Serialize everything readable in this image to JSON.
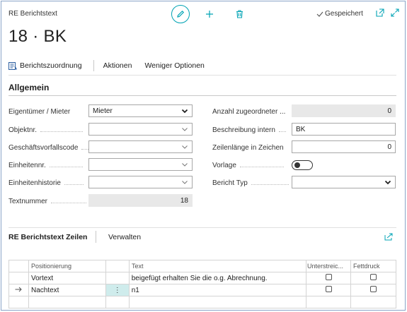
{
  "header": {
    "caption": "RE Berichtstext",
    "title": "18 · BK",
    "saved_label": "Gespeichert"
  },
  "actions": {
    "report_assignment": "Berichtszuordnung",
    "actions": "Aktionen",
    "fewer_options": "Weniger Optionen"
  },
  "general": {
    "section_title": "Allgemein",
    "left": [
      {
        "label": "Eigentümer / Mieter",
        "value": "Mieter"
      },
      {
        "label": "Objektnr.",
        "value": ""
      },
      {
        "label": "Geschäftsvorfallscode",
        "value": ""
      },
      {
        "label": "Einheitennr.",
        "value": ""
      },
      {
        "label": "Einheitenhistorie",
        "value": ""
      },
      {
        "label": "Textnummer",
        "value": "18"
      }
    ],
    "right": [
      {
        "label": "Anzahl zugeordneter ...",
        "value": "0"
      },
      {
        "label": "Beschreibung intern",
        "value": "BK"
      },
      {
        "label": "Zeilenlänge in Zeichen",
        "value": "0"
      },
      {
        "label": "Vorlage",
        "value": "off"
      },
      {
        "label": "Bericht Typ",
        "value": ""
      }
    ]
  },
  "lines": {
    "title": "RE Berichtstext Zeilen",
    "manage": "Verwalten",
    "columns": {
      "positioning": "Positionierung",
      "text": "Text",
      "underline": "Unterstreic...",
      "bold": "Fettdruck"
    },
    "rows": [
      {
        "positioning": "Vortext",
        "text": "beigefügt erhalten Sie die o.g. Abrechnung.",
        "underline": false,
        "bold": false
      },
      {
        "positioning": "Nachtext",
        "text": "n1",
        "underline": false,
        "bold": false
      }
    ]
  },
  "colors": {
    "accent": "#00a3b4",
    "border": "#8aa4c8",
    "selected_cell": "#cfecec"
  }
}
